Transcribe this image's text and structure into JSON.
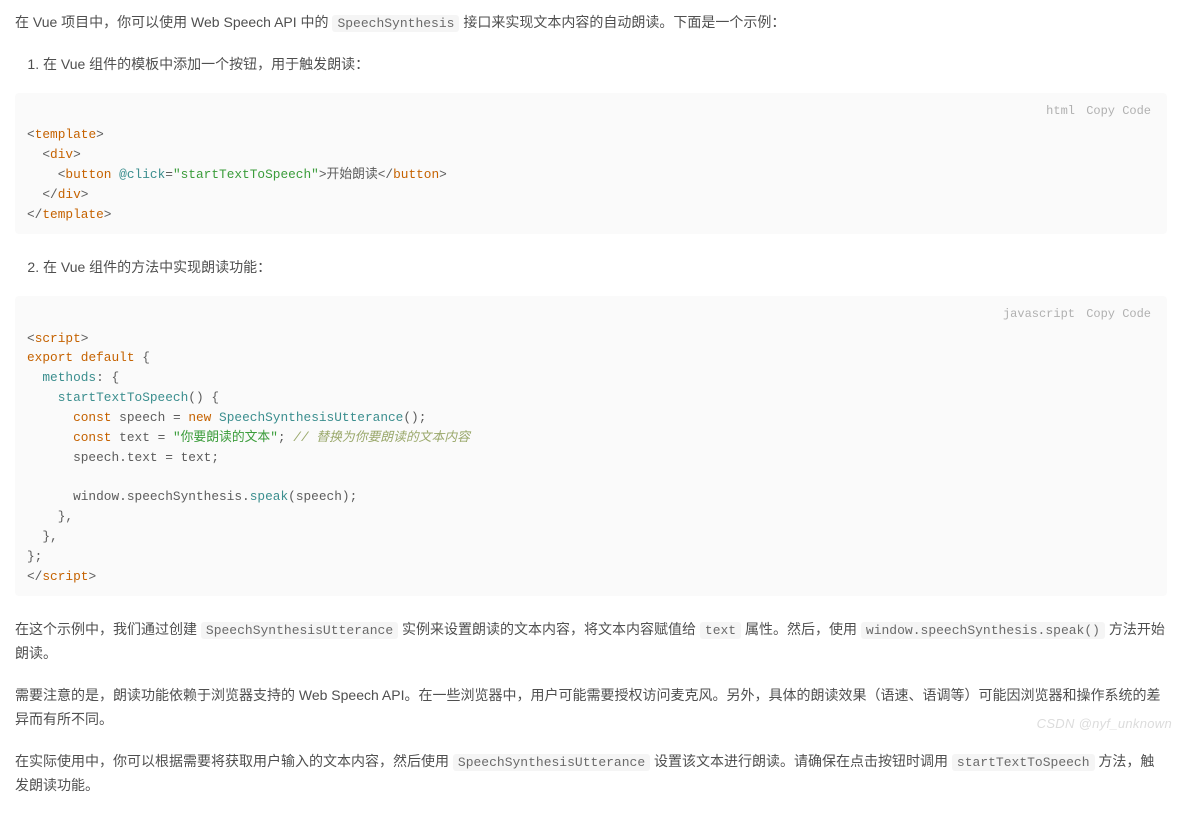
{
  "intro": {
    "pre": "在 Vue 项目中，你可以使用 Web Speech API 中的 ",
    "code": "SpeechSynthesis",
    "post": " 接口来实现文本内容的自动朗读。下面是一个示例："
  },
  "step1": {
    "text": "在 Vue 组件的模板中添加一个按钮，用于触发朗读："
  },
  "code1": {
    "lang": "html",
    "copy": "Copy Code",
    "tokens": {
      "t_template": "template",
      "t_div": "div",
      "t_button": "button",
      "attr_click": "@click",
      "val_click": "\"startTextToSpeech\"",
      "btn_text": "开始朗读"
    }
  },
  "step2": {
    "text": "在 Vue 组件的方法中实现朗读功能："
  },
  "code2": {
    "lang": "javascript",
    "copy": "Copy Code",
    "tokens": {
      "t_script": "script",
      "kw_export": "export",
      "kw_default": "default",
      "methods": "methods",
      "fn_name": "startTextToSpeech",
      "kw_const": "const",
      "var_speech": "speech",
      "kw_new": "new",
      "cls_utter": "SpeechSynthesisUtterance",
      "var_text": "text",
      "str_text": "\"你要朗读的文本\"",
      "comment": "// 替换为你要朗读的文本内容",
      "win": "window",
      "ss": "speechSynthesis",
      "speak": "speak"
    }
  },
  "p1": {
    "a": "在这个示例中，我们通过创建 ",
    "c1": "SpeechSynthesisUtterance",
    "b": " 实例来设置朗读的文本内容，将文本内容赋值给 ",
    "c2": "text",
    "c": " 属性。然后，使用 ",
    "c3": "window.speechSynthesis.speak()",
    "d": " 方法开始朗读。"
  },
  "p2": "需要注意的是，朗读功能依赖于浏览器支持的 Web Speech API。在一些浏览器中，用户可能需要授权访问麦克风。另外，具体的朗读效果（语速、语调等）可能因浏览器和操作系统的差异而有所不同。",
  "p3": {
    "a": "在实际使用中，你可以根据需要将获取用户输入的文本内容，然后使用 ",
    "c1": "SpeechSynthesisUtterance",
    "b": " 设置该文本进行朗读。请确保在点击按钮时调用 ",
    "c2": "startTextToSpeech",
    "c": " 方法，触发朗读功能。"
  },
  "watermark": "CSDN @nyf_unknown"
}
